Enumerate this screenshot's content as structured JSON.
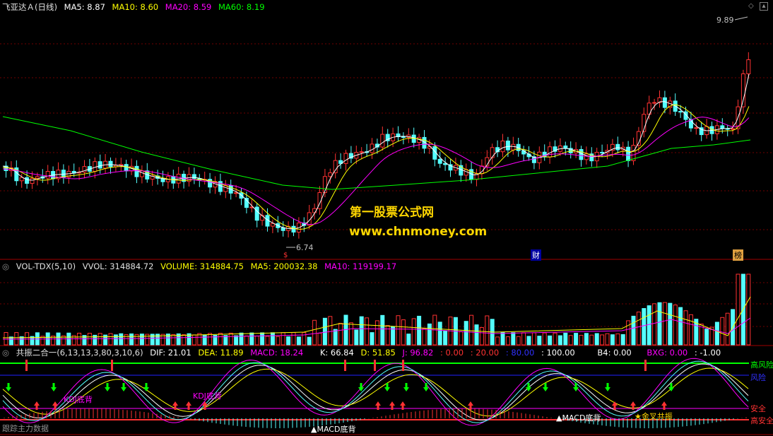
{
  "price_panel": {
    "title": "飞亚达Ａ(日线)",
    "ma5": "MA5: 8.87",
    "ma10": "MA10: 8.60",
    "ma20": "MA20: 8.59",
    "ma60": "MA60: 8.19",
    "high_label": "9.89",
    "low_label": "6.74",
    "marker_cai": "财",
    "marker_bang": "榜",
    "colors": {
      "ma5": "#ffffff",
      "ma10": "#ffff00",
      "ma20": "#ff00ff",
      "ma60": "#00ff00",
      "up": "#ff3232",
      "down": "#54ffff"
    }
  },
  "volume_panel": {
    "name": "VOL-TDX(5,10)",
    "vvol": "VVOL: 314884.72",
    "volume": "VOLUME: 314884.75",
    "ma5": "MA5: 200032.38",
    "ma10": "MA10: 119199.17"
  },
  "indicator_panel": {
    "name": "共振二合一(6,13,13,3,80,3,10,6)",
    "dif": "DIF: 21.01",
    "dea": "DEA: 11.89",
    "macd": "MACD: 18.24",
    "k": "K: 66.84",
    "d": "D: 51.85",
    "j": "J: 96.82",
    "r1": ": 0.00",
    "r2": ": 20.00",
    "r3": ": 80.00",
    "r4": ": 100.00",
    "b4": "B4: 0.00",
    "bxg": "BXG: 0.00",
    "r5": ": -1.00",
    "labels": {
      "high_risk": "高风险",
      "risk": "风险",
      "safe": "安全",
      "high_safe": "高安全",
      "kdj_div1": "KDJ底背",
      "kdj_div2": "KDJ底背",
      "macd_div1": "MACD底背",
      "macd_div2": "MACD底背",
      "resonance": "金叉共振",
      "main_force": "跟踪主力数据"
    }
  },
  "watermark": {
    "line1": "第一股票公式网",
    "line2": "www.chnmoney.com"
  }
}
